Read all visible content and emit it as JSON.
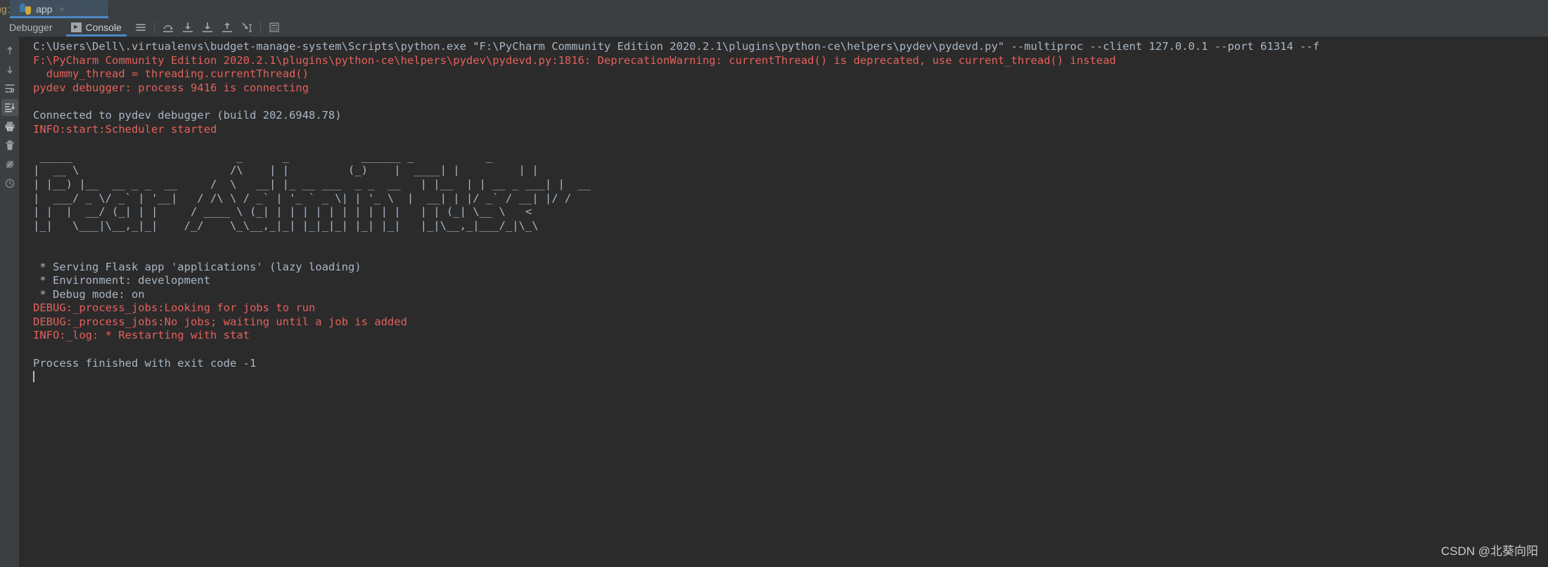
{
  "window": {
    "debug_label": "ug:",
    "config_tab": {
      "title": "app",
      "icon": "python-icon",
      "close": "×"
    }
  },
  "toolbar": {
    "tabs": [
      {
        "label": "Debugger",
        "active": false,
        "icon": null
      },
      {
        "label": "Console",
        "active": true,
        "icon": "console-prompt-icon"
      }
    ],
    "buttons": [
      {
        "name": "menu-icon",
        "title": "Menu"
      },
      {
        "name": "step-over-icon",
        "title": "Step Over"
      },
      {
        "name": "step-into-icon",
        "title": "Step Into"
      },
      {
        "name": "force-step-into-icon",
        "title": "Force Step Into"
      },
      {
        "name": "step-out-icon",
        "title": "Step Out"
      },
      {
        "name": "run-to-cursor-icon",
        "title": "Run to Cursor"
      },
      {
        "name": "evaluate-expression-icon",
        "title": "Evaluate Expression"
      }
    ]
  },
  "sidebar": {
    "items": [
      {
        "name": "up-arrow-icon",
        "title": "Up the Stack Trace",
        "selected": false
      },
      {
        "name": "down-arrow-icon",
        "title": "Down the Stack Trace",
        "selected": false
      },
      {
        "name": "soft-wrap-icon",
        "title": "Use Soft Wraps",
        "selected": false
      },
      {
        "name": "scroll-to-end-icon",
        "title": "Scroll to the End",
        "selected": true
      },
      {
        "name": "print-icon",
        "title": "Print",
        "selected": false
      },
      {
        "name": "trash-icon",
        "title": "Clear All",
        "selected": false
      },
      {
        "name": "mute-breakpoints-icon",
        "title": "Mute Breakpoints",
        "selected": false
      },
      {
        "name": "history-icon",
        "title": "History",
        "selected": false
      }
    ]
  },
  "console": {
    "lines": [
      {
        "text": "C:\\Users\\Dell\\.virtualenvs\\budget-manage-system\\Scripts\\python.exe \"F:\\PyCharm Community Edition 2020.2.1\\plugins\\python-ce\\helpers\\pydev\\pydevd.py\" --multiproc --client 127.0.0.1 --port 61314 --f",
        "type": "out"
      },
      {
        "text": "F:\\PyCharm Community Edition 2020.2.1\\plugins\\python-ce\\helpers\\pydev\\pydevd.py:1816: DeprecationWarning: currentThread() is deprecated, use current_thread() instead",
        "type": "err"
      },
      {
        "text": "  dummy_thread = threading.currentThread()",
        "type": "err"
      },
      {
        "text": "pydev debugger: process 9416 is connecting",
        "type": "err"
      },
      {
        "text": "",
        "type": "out"
      },
      {
        "text": "Connected to pydev debugger (build 202.6948.78)",
        "type": "out"
      },
      {
        "text": "INFO:start:Scheduler started",
        "type": "err"
      },
      {
        "text": "",
        "type": "out"
      },
      {
        "text": " _____                         _      _           ______ _           _",
        "type": "out"
      },
      {
        "text": "|  __ \\                       /\\    | |         (_)    |  ____| |         | |",
        "type": "out"
      },
      {
        "text": "| |__) |__  __ _ _  __     /  \\   __| |_ __ ___  _ _  __   | |__  | | __ _ ___| |  __",
        "type": "out"
      },
      {
        "text": "|  ___/ _ \\/ _` | '__|   / /\\ \\ / _` | '_ ` _ \\| | '_ \\  |  __| | |/ _` / __| |/ /",
        "type": "out"
      },
      {
        "text": "| |  |  __/ (_| | |     / ____ \\ (_| | | | | | | | | | |   | | (_| \\__ \\   <",
        "type": "out"
      },
      {
        "text": "|_|   \\___|\\__,_|_|    /_/    \\_\\__,_|_| |_|_|_| |_| |_|   |_|\\__,_|___/_|\\_\\",
        "type": "out"
      },
      {
        "text": "",
        "type": "out"
      },
      {
        "text": "",
        "type": "out"
      },
      {
        "text": " * Serving Flask app 'applications' (lazy loading)",
        "type": "out"
      },
      {
        "text": " * Environment: development",
        "type": "out"
      },
      {
        "text": " * Debug mode: on",
        "type": "out"
      },
      {
        "text": "DEBUG:_process_jobs:Looking for jobs to run",
        "type": "err"
      },
      {
        "text": "DEBUG:_process_jobs:No jobs; waiting until a job is added",
        "type": "err"
      },
      {
        "text": "INFO:_log: * Restarting with stat",
        "type": "err"
      },
      {
        "text": "",
        "type": "out"
      },
      {
        "text": "Process finished with exit code -1",
        "type": "out"
      }
    ]
  },
  "watermark": {
    "text": "CSDN @北葵向阳"
  },
  "colors": {
    "console_bg": "#2b2b2b",
    "chrome_bg": "#3c3f41",
    "text": "#a9b7c6",
    "error_text": "#e4605b",
    "accent": "#4a88c7",
    "active_tab_bg": "#41505e",
    "config_label": "#b9a36a"
  }
}
